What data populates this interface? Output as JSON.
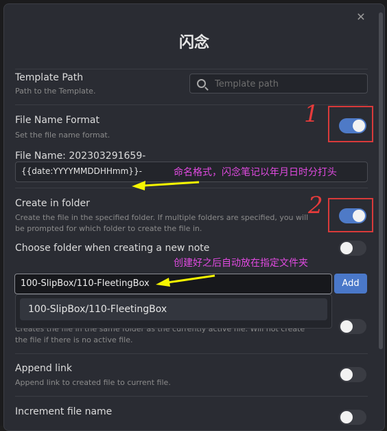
{
  "modal": {
    "title": "闪念",
    "close_glyph": "✕"
  },
  "settings": {
    "template_path": {
      "name": "Template Path",
      "desc": "Path to the Template.",
      "placeholder": "Template path"
    },
    "file_name_format": {
      "name": "File Name Format",
      "desc": "Set the file name format.",
      "enabled": true,
      "preview_label": "File Name: 202303291659-",
      "value": "{{date:YYYYMMDDHHmm}}-"
    },
    "create_in_folder": {
      "name": "Create in folder",
      "desc_line1": "Create the file in the specified folder. If multiple folders are specified, you will",
      "desc_line2": "be prompted for which folder to create the file in.",
      "enabled": true
    },
    "choose_folder": {
      "name": "Choose folder when creating a new note",
      "enabled": false,
      "folder_value": "100-SlipBox/110-FleetingBox",
      "add_label": "Add",
      "suggestion": "100-SlipBox/110-FleetingBox"
    },
    "same_folder": {
      "desc_line1": "Creates the file in the same folder as the currently active file. Will not create",
      "desc_line2": "the file if there is no active file.",
      "enabled": false
    },
    "append_link": {
      "name": "Append link",
      "desc": "Append link to created file to current file.",
      "enabled": false
    },
    "increment_file_name": {
      "name": "Increment file name",
      "enabled": false
    }
  },
  "annotations": {
    "num1": "1",
    "num2": "2",
    "note_format": "命名格式，闪念笔记以年月日时分打头",
    "note_folder": "创建好之后自动放在指定文件夹"
  },
  "colors": {
    "accent": "#4e7ac7",
    "annotation": "#e04ae0",
    "highlight_box": "#d93a3a",
    "arrow": "#f5f500"
  }
}
